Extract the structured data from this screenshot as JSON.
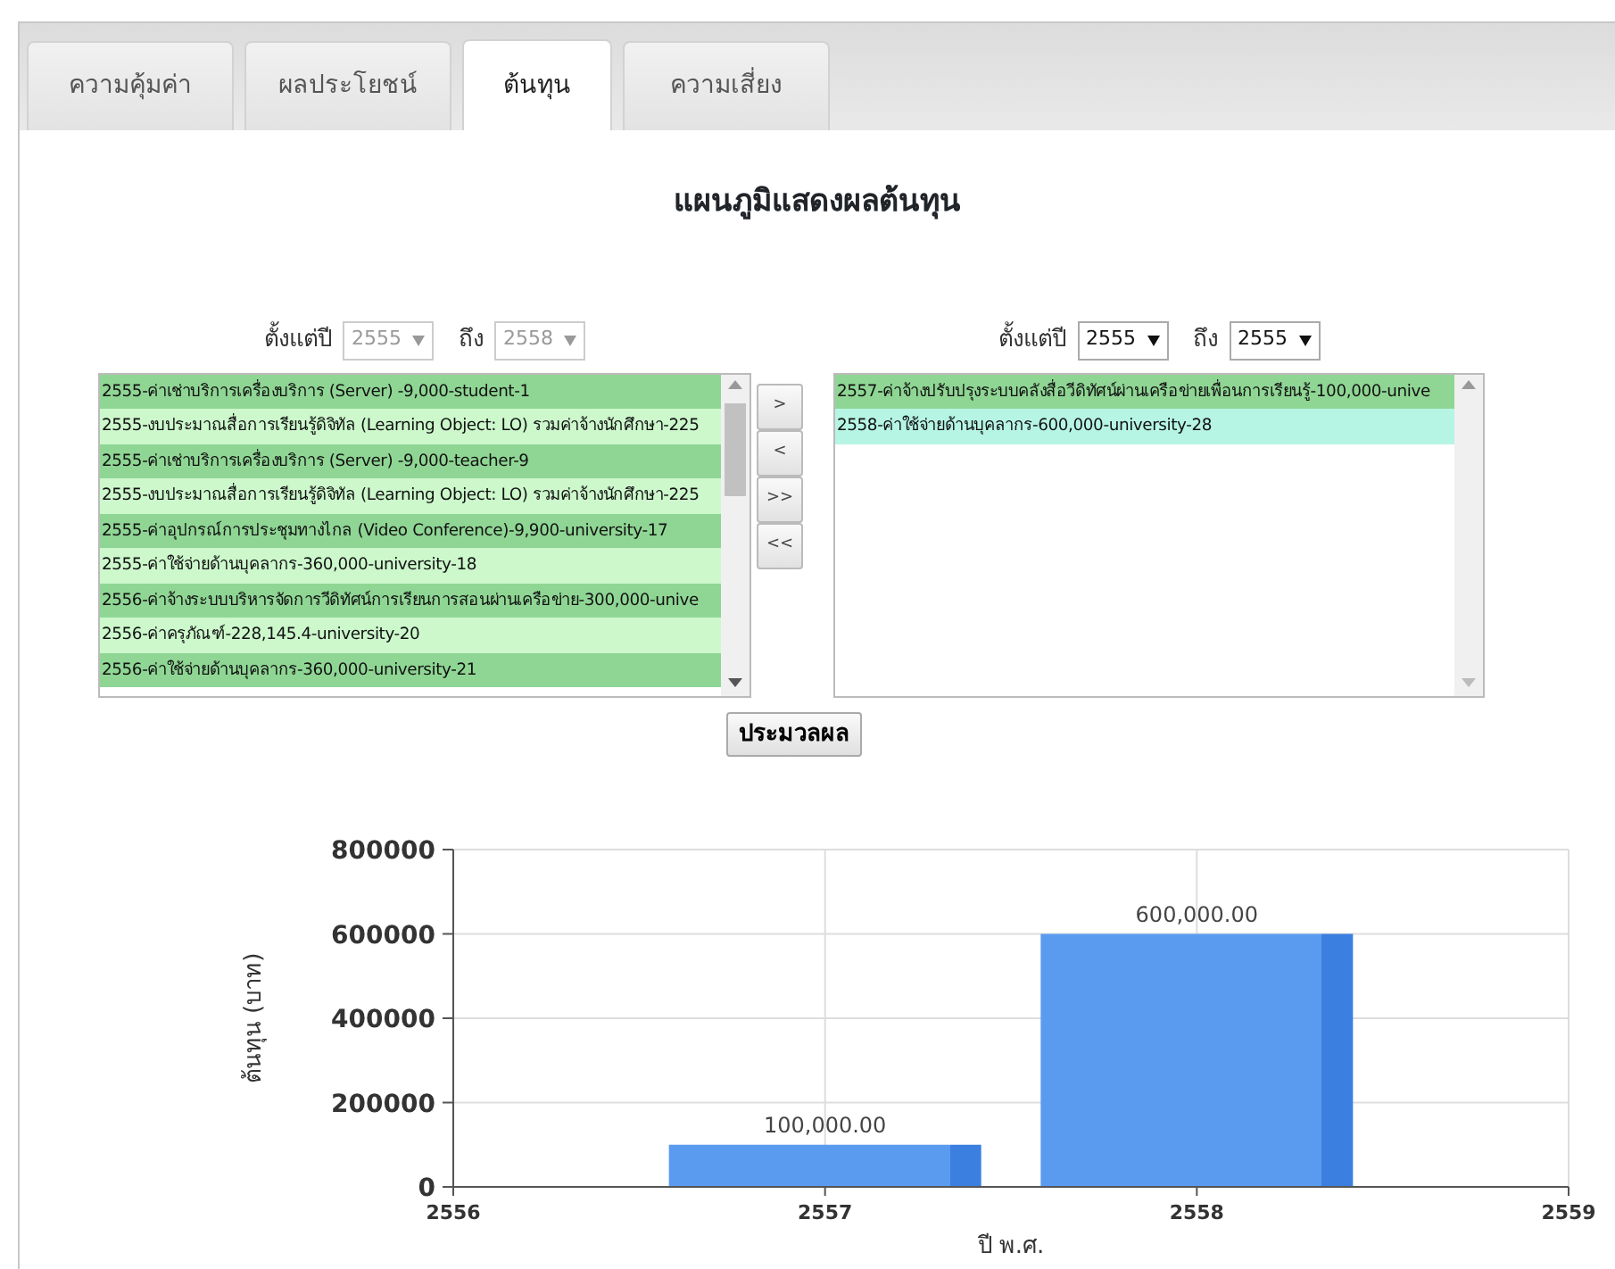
{
  "tabs": [
    {
      "label": "ความคุ้มค่า",
      "selected": false
    },
    {
      "label": "ผลประโยชน์",
      "selected": false
    },
    {
      "label": "ต้นทุน",
      "selected": true
    },
    {
      "label": "ความเสี่ยง",
      "selected": false
    }
  ],
  "title": "แผนภูมิแสดงผลต้นทุน",
  "left_panel": {
    "from_label": "ตั้งแต่ปี",
    "from_value": "2555",
    "to_label": "ถึง",
    "to_value": "2558",
    "disabled": true,
    "items": [
      {
        "text": "2555-ค่าเช่าบริการเครื่องบริการ (Server) -9,000-student-1",
        "selected": false
      },
      {
        "text": "2555-งบประมาณสื่อการเรียนรู้ดิจิทัล (Learning Object: LO) รวมค่าจ้างนักศึกษา-225",
        "selected": false
      },
      {
        "text": "2555-ค่าเช่าบริการเครื่องบริการ (Server) -9,000-teacher-9",
        "selected": false
      },
      {
        "text": "2555-งบประมาณสื่อการเรียนรู้ดิจิทัล (Learning Object: LO) รวมค่าจ้างนักศึกษา-225",
        "selected": false
      },
      {
        "text": "2555-ค่าอุปกรณ์การประชุมทางไกล (Video Conference)-9,900-university-17",
        "selected": false
      },
      {
        "text": "2555-ค่าใช้จ่ายด้านบุคลากร-360,000-university-18",
        "selected": false
      },
      {
        "text": "2556-ค่าจ้างระบบบริหารจัดการวีดิทัศน์การเรียนการสอนผ่านเครือข่าย-300,000-unive",
        "selected": false
      },
      {
        "text": "2556-ค่าครุภัณฑ์-228,145.4-university-20",
        "selected": false
      },
      {
        "text": "2556-ค่าใช้จ่ายด้านบุคลากร-360,000-university-21",
        "selected": false
      }
    ]
  },
  "move_buttons": [
    ">",
    "<",
    ">>",
    "<<"
  ],
  "right_panel": {
    "from_label": "ตั้งแต่ปี",
    "from_value": "2555",
    "to_label": "ถึง",
    "to_value": "2555",
    "disabled": false,
    "items": [
      {
        "text": "2557-ค่าจ้างปรับปรุงระบบคลังสื่อวีดิทัศน์ผ่านเครือข่ายเพื่อนการเรียนรู้-100,000-unive",
        "selected": false
      },
      {
        "text": "2558-ค่าใช้จ่ายด้านบุคลากร-600,000-university-28",
        "selected": true
      }
    ]
  },
  "process_button": "ประมวลผล",
  "chart_data": {
    "type": "bar",
    "xlabel": "ปี พ.ศ.",
    "ylabel": "ต้นทุน (บาท)",
    "x": [
      2557,
      2558
    ],
    "series": [
      {
        "color": "#5b9bef",
        "values": [
          100000,
          600000
        ]
      }
    ],
    "xlim": [
      2556,
      2559
    ],
    "ylim": [
      0,
      800000
    ],
    "xticks": [
      2556,
      2557,
      2558,
      2559
    ],
    "yticks": [
      0,
      200000,
      400000,
      600000,
      800000
    ],
    "grid": true,
    "value_labels": [
      "100,000.00",
      "600,000.00"
    ]
  }
}
